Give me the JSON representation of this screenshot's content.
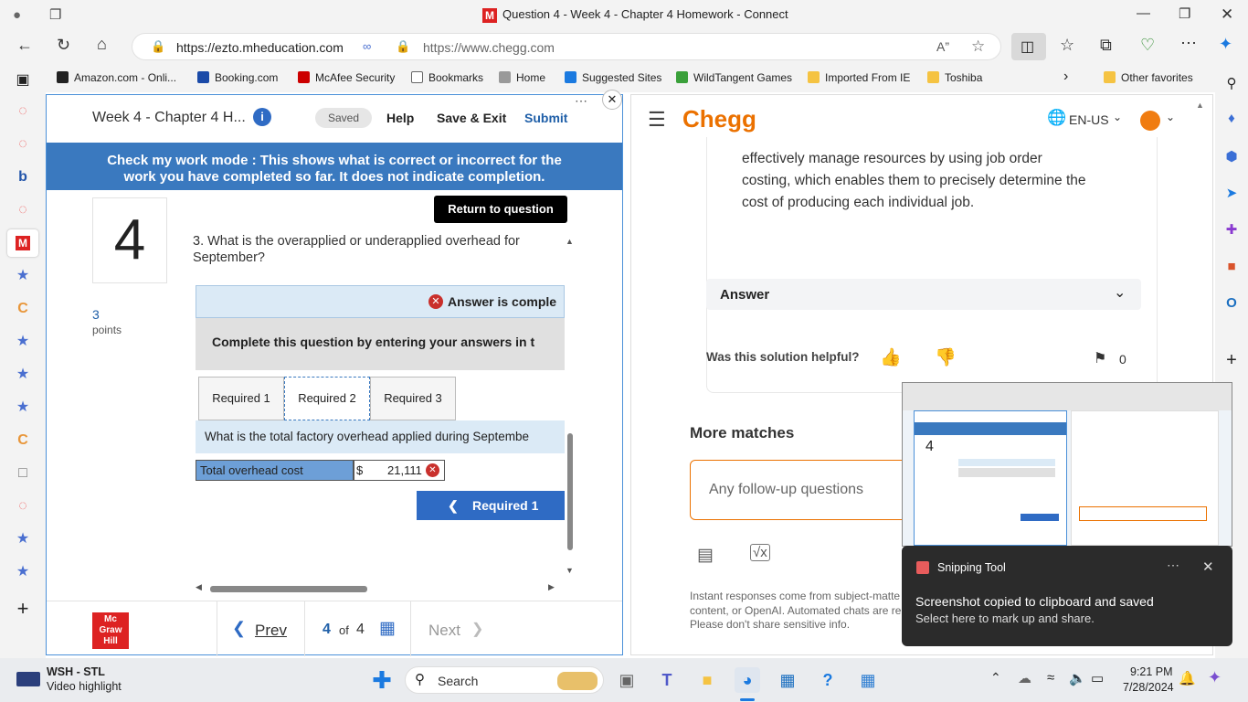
{
  "window": {
    "title": "Question 4 - Week 4 - Chapter 4 Homework - Connect",
    "tab_icon_letter": "M"
  },
  "nav": {
    "url_left": "https://ezto.mheducation.com",
    "url_right": "https://www.chegg.com"
  },
  "bookmarks": [
    {
      "label": "Amazon.com - Onli...",
      "icon": "amazon-icon",
      "color": "#222"
    },
    {
      "label": "Booking.com",
      "icon": "booking-icon",
      "color": "#1a4aa8"
    },
    {
      "label": "McAfee Security",
      "icon": "mcafee-icon",
      "color": "#c00"
    },
    {
      "label": "Bookmarks",
      "icon": "page-icon",
      "color": "#888"
    },
    {
      "label": "Home",
      "icon": "home-icon",
      "color": "#666"
    },
    {
      "label": "Suggested Sites",
      "icon": "bing-icon",
      "color": "#1b7ae0"
    },
    {
      "label": "WildTangent Games",
      "icon": "wildtangent-icon",
      "color": "#3aa03a"
    },
    {
      "label": "Imported From IE",
      "icon": "folder-icon",
      "color": "#f5c342"
    },
    {
      "label": "Toshiba",
      "icon": "folder-icon",
      "color": "#f5c342"
    }
  ],
  "bookmarks_other": "Other favorites",
  "connect": {
    "assignment_title": "Week 4 - Chapter 4 H...",
    "saved": "Saved",
    "help": "Help",
    "save_exit": "Save & Exit",
    "submit": "Submit",
    "banner_line1": "Check my work mode : This shows what is correct or incorrect for the",
    "banner_line2": "work you have completed so far. It does not indicate completion.",
    "return_btn": "Return to question",
    "question_number": "4",
    "points_value": "3",
    "points_label": "points",
    "question_text": "3. What is the overapplied or underapplied overhead for September?",
    "answer_status": "Answer is comple",
    "instruction": "Complete this question by entering your answers in t",
    "tabs": [
      "Required 1",
      "Required 2",
      "Required 3"
    ],
    "active_tab": 1,
    "subquestion": "What is the total factory overhead applied during Septembe",
    "row_label": "Total overhead cost",
    "currency": "$",
    "row_value": "21,111",
    "prev_req_btn": "Required 1",
    "footer": {
      "logo": [
        "Mc",
        "Graw",
        "Hill"
      ],
      "prev": "Prev",
      "page_current": "4",
      "page_of": "of",
      "page_total": "4",
      "next": "Next"
    }
  },
  "chegg": {
    "logo": "Chegg",
    "lang": "EN-US",
    "answer_text_line1": "effectively manage resources by using job order",
    "answer_text_line2": "costing, which enables them to precisely determine the",
    "answer_text_line3": "cost of producing each individual job.",
    "answer_header": "Answer",
    "helpful": "Was this solution helpful?",
    "bookmark_count": "0",
    "more_matches": "More matches",
    "followup_placeholder": "Any follow-up questions",
    "disclaimer_line1": "Instant responses come from subject-matte",
    "disclaimer_line2": "content, or OpenAI. Automated chats are re",
    "disclaimer_line3": "Please don't share sensitive info."
  },
  "snipping": {
    "app": "Snipping Tool",
    "line1": "Screenshot copied to clipboard and saved",
    "line2": "Select here to mark up and share."
  },
  "taskbar": {
    "news_title": "WSH - STL",
    "news_sub": "Video highlight",
    "search": "Search",
    "time": "9:21 PM",
    "date": "7/28/2024"
  }
}
